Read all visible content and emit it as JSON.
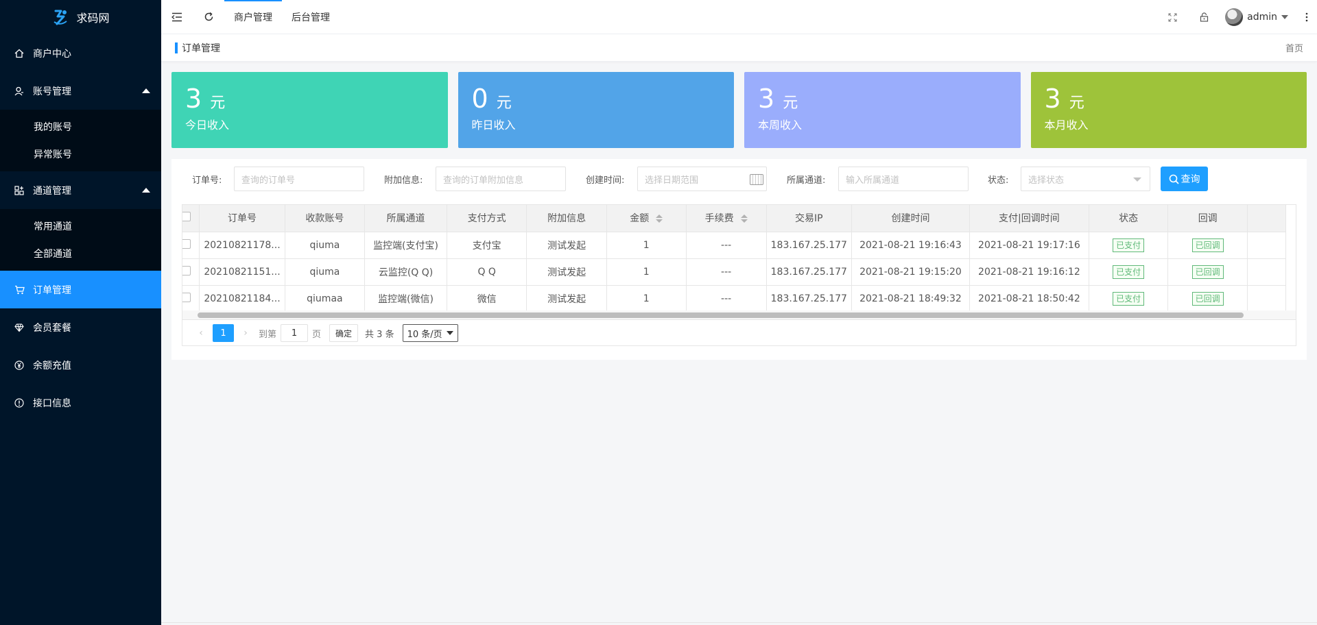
{
  "brand": {
    "name": "求码网"
  },
  "sidebar": {
    "items": [
      {
        "label": "商户中心"
      },
      {
        "label": "账号管理",
        "children": [
          {
            "label": "我的账号"
          },
          {
            "label": "异常账号"
          }
        ]
      },
      {
        "label": "通道管理",
        "children": [
          {
            "label": "常用通道"
          },
          {
            "label": "全部通道"
          }
        ]
      },
      {
        "label": "订单管理"
      },
      {
        "label": "会员套餐"
      },
      {
        "label": "余额充值"
      },
      {
        "label": "接口信息"
      }
    ]
  },
  "header": {
    "tabs": [
      {
        "label": "商户管理"
      },
      {
        "label": "后台管理"
      }
    ],
    "user": "admin"
  },
  "breadcrumb": {
    "title": "订单管理",
    "home": "首页"
  },
  "cards": [
    {
      "value": "3",
      "unit": "元",
      "label": "今日收入",
      "color": "#3fd4b5"
    },
    {
      "value": "0",
      "unit": "元",
      "label": "昨日收入",
      "color": "#52a4e8"
    },
    {
      "value": "3",
      "unit": "元",
      "label": "本周收入",
      "color": "#9aadfc"
    },
    {
      "value": "3",
      "unit": "元",
      "label": "本月收入",
      "color": "#9ec33a"
    }
  ],
  "filters": {
    "order_no": {
      "label": "订单号:",
      "placeholder": "查询的订单号"
    },
    "extra": {
      "label": "附加信息:",
      "placeholder": "查询的订单附加信息"
    },
    "created": {
      "label": "创建时间:",
      "placeholder": "选择日期范围"
    },
    "channel": {
      "label": "所属通道:",
      "placeholder": "输入所属通道"
    },
    "status": {
      "label": "状态:",
      "placeholder": "选择状态"
    },
    "query_button": "查询"
  },
  "table": {
    "columns": [
      "订单号",
      "收款账号",
      "所属通道",
      "支付方式",
      "附加信息",
      "金额",
      "手续费",
      "交易IP",
      "创建时间",
      "支付|回调时间",
      "状态",
      "回调"
    ],
    "rows": [
      [
        "20210821178...",
        "qiuma",
        "监控端(支付宝)",
        "支付宝",
        "测试发起",
        "1",
        "---",
        "183.167.25.177",
        "2021-08-21 19:16:43",
        "2021-08-21 19:17:16",
        "已支付",
        "已回调"
      ],
      [
        "20210821151...",
        "qiuma",
        "云监控(Q Q)",
        "Q Q",
        "测试发起",
        "1",
        "---",
        "183.167.25.177",
        "2021-08-21 19:15:20",
        "2021-08-21 19:16:12",
        "已支付",
        "已回调"
      ],
      [
        "20210821184...",
        "qiumaa",
        "监控端(微信)",
        "微信",
        "测试发起",
        "1",
        "---",
        "183.167.25.177",
        "2021-08-21 18:49:32",
        "2021-08-21 18:50:42",
        "已支付",
        "已回调"
      ]
    ]
  },
  "pager": {
    "current": "1",
    "goto_label": "到第",
    "goto_value": "1",
    "page_unit": "页",
    "confirm": "确定",
    "total": "共 3 条",
    "page_size": "10 条/页"
  }
}
